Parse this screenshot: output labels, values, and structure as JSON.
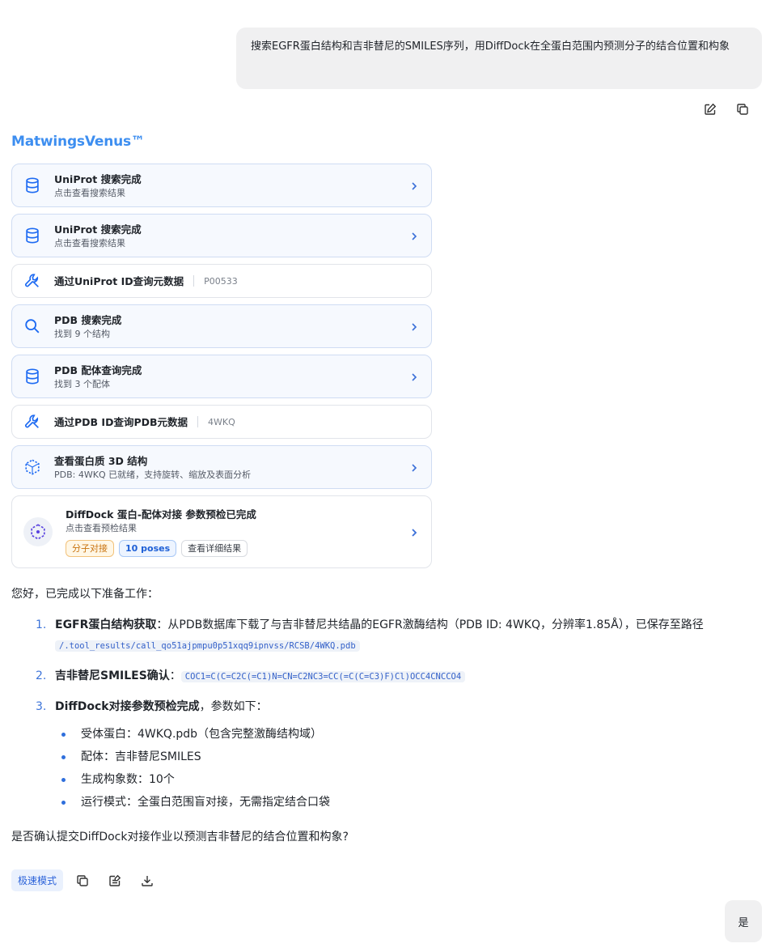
{
  "user_message": "搜索EGFR蛋白结构和吉非替尼的SMILES序列，用DiffDock在全蛋白范围内预测分子的结合位置和构象",
  "brand": "MatwingsVenus™",
  "cards": [
    {
      "title": "UniProt 搜索完成",
      "sub": "点击查看搜索结果"
    },
    {
      "title": "UniProt 搜索完成",
      "sub": "点击查看搜索结果"
    },
    {
      "title": "通过UniProt ID查询元数据",
      "tag": "P00533"
    },
    {
      "title": "PDB 搜索完成",
      "sub": "找到 9 个结构"
    },
    {
      "title": "PDB 配体查询完成",
      "sub": "找到 3 个配体"
    },
    {
      "title": "通过PDB ID查询PDB元数据",
      "tag": "4WKQ"
    },
    {
      "title": "查看蛋白质 3D 结构",
      "sub": "PDB: 4WKQ 已就绪，支持旋转、缩放及表面分析"
    }
  ],
  "diffdock_card": {
    "title": "DiffDock 蛋白-配体对接 参数预检已完成",
    "sub": "点击查看预检结果",
    "badges": [
      "分子对接",
      "10 poses",
      "查看详细结果"
    ]
  },
  "answer": {
    "intro": "您好，已完成以下准备工作：",
    "items": [
      {
        "num": "1.",
        "bold": "EGFR蛋白结构获取",
        "text": "：从PDB数据库下载了与吉非替尼共结晶的EGFR激酶结构（PDB ID: 4WKQ，分辨率1.85Å），已保存至路径 ",
        "code": "/.tool_results/call_qo51ajpmpu0p51xqq9ipnvss/RCSB/4WKQ.pdb"
      },
      {
        "num": "2.",
        "bold": "吉非替尼SMILES确认",
        "text": "：",
        "code": "COC1=C(C=C2C(=C1)N=CN=C2NC3=CC(=C(C=C3)F)Cl)OCC4CNCCO4"
      },
      {
        "num": "3.",
        "bold": "DiffDock对接参数预检完成",
        "text": "，参数如下："
      }
    ],
    "bullets": [
      "受体蛋白：4WKQ.pdb（包含完整激酶结构域）",
      "配体：吉非替尼SMILES",
      "生成构象数：10个",
      "运行模式：全蛋白范围盲对接，无需指定结合口袋"
    ],
    "question": "是否确认提交DiffDock对接作业以预测吉非替尼的结合位置和构象?"
  },
  "bottom": {
    "mode": "极速模式"
  },
  "user_reply": "是"
}
